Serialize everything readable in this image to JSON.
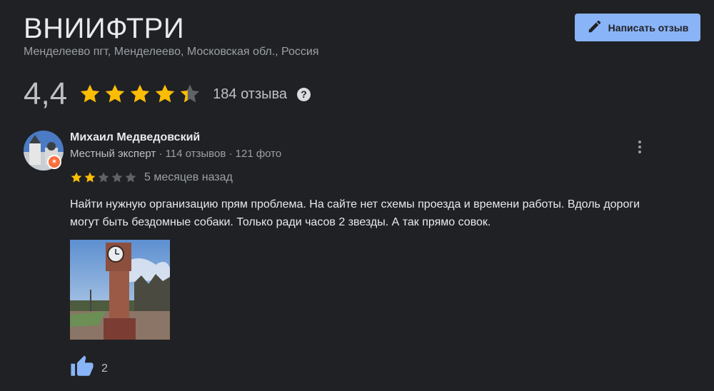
{
  "place": {
    "title": "ВНИИФТРИ",
    "address": "Менделеево пгт, Менделеево, Московская обл., Россия"
  },
  "header": {
    "write_review_label": "Написать отзыв",
    "write_review_icon": "pencil-icon"
  },
  "rating": {
    "value": "4,4",
    "stars": 4.4,
    "review_count_label": "184 отзыва",
    "help_icon": "?"
  },
  "review": {
    "author": "Михаил Медведовский",
    "badge": "Местный эксперт",
    "meta": " · 114 отзывов · 121 фото",
    "stars": 2,
    "date": "5 месяцев назад",
    "text": "Найти нужную организацию прям проблема. На сайте нет схемы проезда и времени работы. Вдоль дороги могут быть бездомные собаки. Только ради часов 2 звезды. А так прямо совок.",
    "likes": "2",
    "like_icon": "thumbs-up-icon",
    "more_icon": "more-vert-icon"
  },
  "colors": {
    "background": "#202124",
    "accent": "#8ab4f8",
    "star": "#fbbc04",
    "star_empty": "#5f6368",
    "like": "#8ab4f8"
  }
}
